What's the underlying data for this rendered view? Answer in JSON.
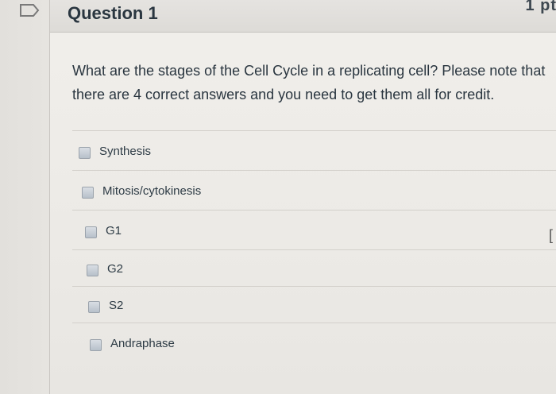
{
  "question": {
    "title": "Question 1",
    "points": "1 pt",
    "text": "What are the stages of the Cell Cycle in a replicating cell? Please note that there are 4 correct answers and you need to get them all for credit."
  },
  "answers": [
    {
      "label": "Synthesis",
      "checked": false
    },
    {
      "label": "Mitosis/cytokinesis",
      "checked": false
    },
    {
      "label": "G1",
      "checked": false
    },
    {
      "label": "G2",
      "checked": false
    },
    {
      "label": "S2",
      "checked": false
    },
    {
      "label": "Andraphase",
      "checked": false
    }
  ]
}
